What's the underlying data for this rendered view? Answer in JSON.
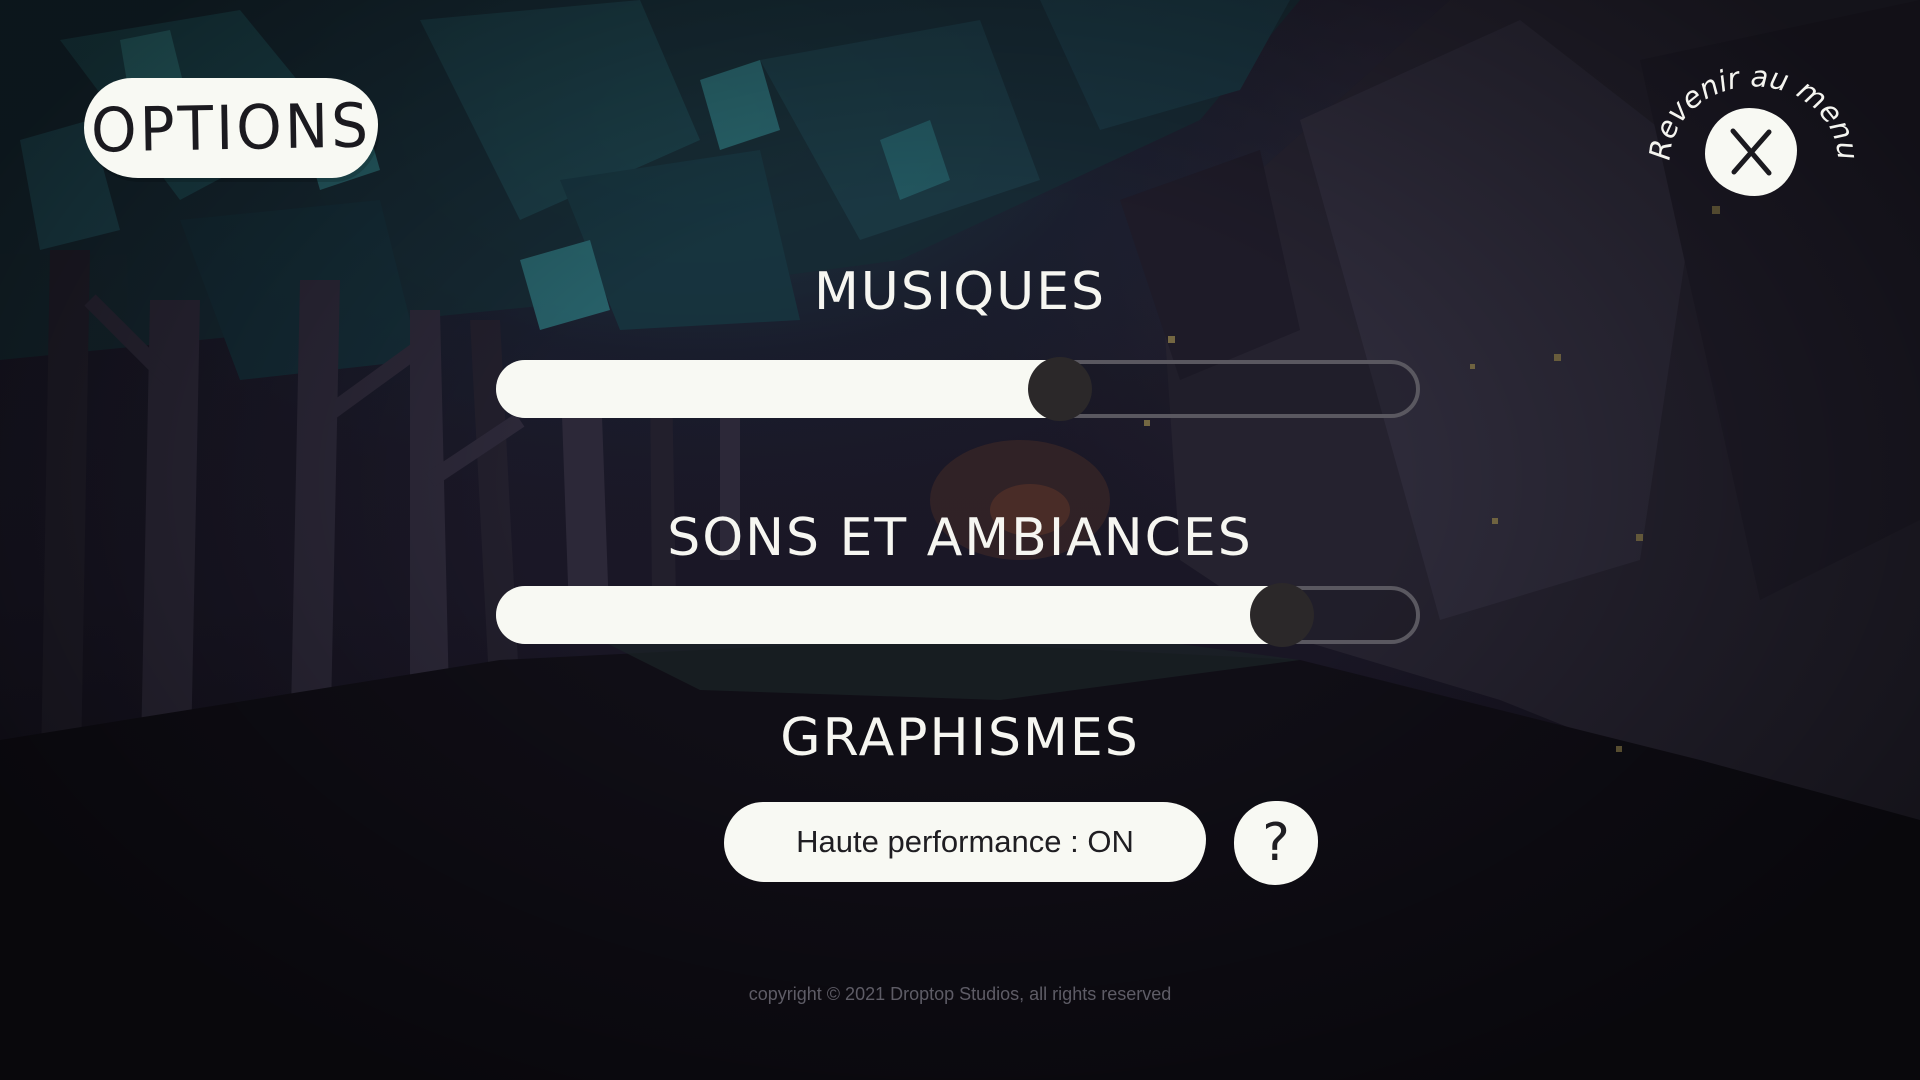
{
  "options": {
    "title": "OPTIONS",
    "back_to_menu_label": "Revenir au menu",
    "close_glyph": "X"
  },
  "music": {
    "label": "MUSIQUES",
    "volume": 0.62
  },
  "sound": {
    "label": "SONS ET AMBIANCES",
    "volume": 0.88
  },
  "graphics": {
    "label": "GRAPHISMES",
    "performance_button": "Haute performance : ON",
    "help_glyph": "?"
  },
  "footer": {
    "copyright": "copyright © 2021 Droptop Studios, all rights reserved"
  },
  "colors": {
    "panel": "#f8f9f3",
    "thumb": "#2b2829",
    "background": "#15121e"
  }
}
